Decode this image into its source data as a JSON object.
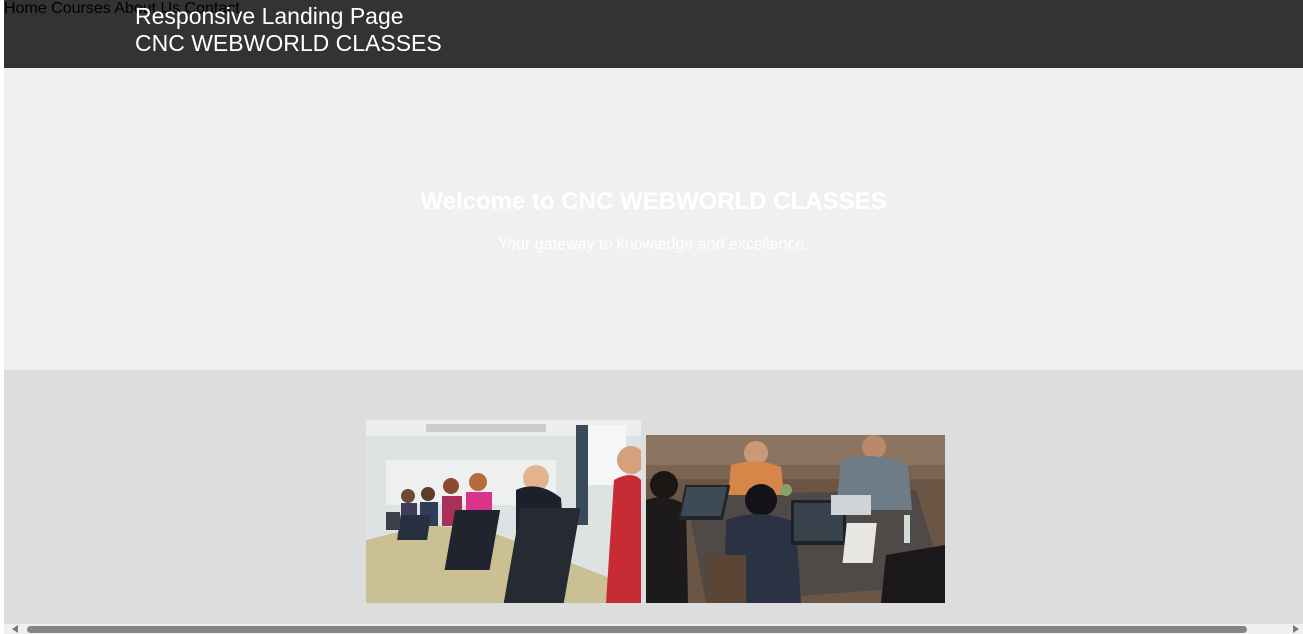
{
  "header": {
    "title_line1": "Responsive Landing Page",
    "title_line2": "CNC WEBWORLD CLASSES",
    "background": "#333333"
  },
  "nav": {
    "items": [
      {
        "label": "Home"
      },
      {
        "label": "Courses"
      },
      {
        "label": "About Us"
      },
      {
        "label": "Contact"
      }
    ]
  },
  "hero": {
    "title": "Welcome to CNC WEBWORLD CLASSES",
    "subtitle": "Your gateway to knowledge and excellence."
  },
  "gallery": {
    "images": [
      {
        "icon": "classroom-students-laptops-photo"
      },
      {
        "icon": "team-working-laptops-photo"
      }
    ]
  }
}
